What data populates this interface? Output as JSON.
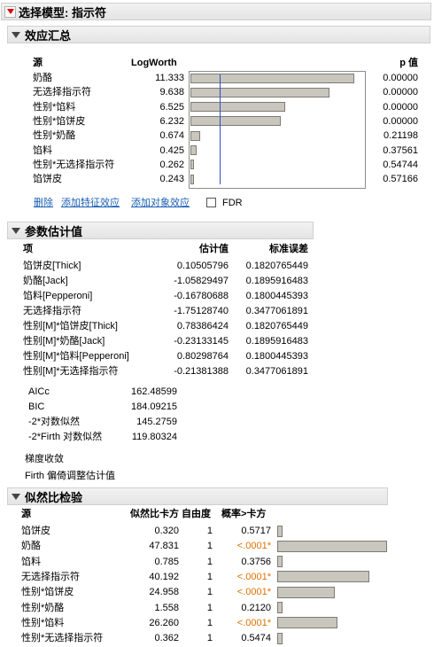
{
  "root_title": "选择模型: 指示符",
  "effect_summary": {
    "title": "效应汇总",
    "columns": {
      "source": "源",
      "logworth": "LogWorth",
      "pvalue": "p 值"
    },
    "rows": [
      {
        "source": "奶酪",
        "logworth": "11.333",
        "lw": 11.333,
        "p": "0.00000"
      },
      {
        "source": "无选择指示符",
        "logworth": "9.638",
        "lw": 9.638,
        "p": "0.00000"
      },
      {
        "source": "性别*馅料",
        "logworth": "6.525",
        "lw": 6.525,
        "p": "0.00000"
      },
      {
        "source": "性别*馅饼皮",
        "logworth": "6.232",
        "lw": 6.232,
        "p": "0.00000"
      },
      {
        "source": "性别*奶酪",
        "logworth": "0.674",
        "lw": 0.674,
        "p": "0.21198"
      },
      {
        "source": "馅料",
        "logworth": "0.425",
        "lw": 0.425,
        "p": "0.37561"
      },
      {
        "source": "性别*无选择指示符",
        "logworth": "0.262",
        "lw": 0.262,
        "p": "0.54744"
      },
      {
        "source": "馅饼皮",
        "logworth": "0.243",
        "lw": 0.243,
        "p": "0.57166"
      }
    ],
    "reference_logworth": 2,
    "max_logworth": 12,
    "actions": {
      "remove": "删除",
      "add_feature": "添加特征效应",
      "add_subject": "添加对象效应",
      "fdr": "FDR"
    }
  },
  "param_estimates": {
    "title": "参数估计值",
    "columns": {
      "term": "项",
      "estimate": "估计值",
      "stderr": "标准误差"
    },
    "rows": [
      {
        "term": "馅饼皮[Thick]",
        "estimate": "0.10505796",
        "stderr": "0.1820765449"
      },
      {
        "term": "奶酪[Jack]",
        "estimate": "-1.05829497",
        "stderr": "0.1895916483"
      },
      {
        "term": "馅料[Pepperoni]",
        "estimate": "-0.16780688",
        "stderr": "0.1800445393"
      },
      {
        "term": "无选择指示符",
        "estimate": "-1.75128740",
        "stderr": "0.3477061891"
      },
      {
        "term": "性别[M]*馅饼皮[Thick]",
        "estimate": "0.78386424",
        "stderr": "0.1820765449"
      },
      {
        "term": "性别[M]*奶酪[Jack]",
        "estimate": "-0.23133145",
        "stderr": "0.1895916483"
      },
      {
        "term": "性别[M]*馅料[Pepperoni]",
        "estimate": "0.80298764",
        "stderr": "0.1800445393"
      },
      {
        "term": "性别[M]*无选择指示符",
        "estimate": "-0.21381388",
        "stderr": "0.3477061891"
      }
    ],
    "fit_stats": [
      {
        "label": "AICc",
        "value": "162.48599"
      },
      {
        "label": "BIC",
        "value": "184.09215"
      },
      {
        "label": "-2*对数似然",
        "value": "145.2759"
      },
      {
        "label": "-2*Firth 对数似然",
        "value": "119.80324"
      }
    ],
    "notes": [
      "梯度收敛",
      "Firth 偏倚调整估计值"
    ]
  },
  "lr_tests": {
    "title": "似然比检验",
    "columns": {
      "source": "源",
      "chisq": "似然比卡方",
      "df": "自由度",
      "prob": "概率>卡方"
    },
    "rows": [
      {
        "source": "馅饼皮",
        "chisq": "0.320",
        "chisq_v": 0.32,
        "df": "1",
        "prob": "0.5717",
        "sig": false
      },
      {
        "source": "奶酪",
        "chisq": "47.831",
        "chisq_v": 47.831,
        "df": "1",
        "prob": "<.0001*",
        "sig": true
      },
      {
        "source": "馅料",
        "chisq": "0.785",
        "chisq_v": 0.785,
        "df": "1",
        "prob": "0.3756",
        "sig": false
      },
      {
        "source": "无选择指示符",
        "chisq": "40.192",
        "chisq_v": 40.192,
        "df": "1",
        "prob": "<.0001*",
        "sig": true
      },
      {
        "source": "性别*馅饼皮",
        "chisq": "24.958",
        "chisq_v": 24.958,
        "df": "1",
        "prob": "<.0001*",
        "sig": true
      },
      {
        "source": "性别*奶酪",
        "chisq": "1.558",
        "chisq_v": 1.558,
        "df": "1",
        "prob": "0.2120",
        "sig": false
      },
      {
        "source": "性别*馅料",
        "chisq": "26.260",
        "chisq_v": 26.26,
        "df": "1",
        "prob": "<.0001*",
        "sig": true
      },
      {
        "source": "性别*无选择指示符",
        "chisq": "0.362",
        "chisq_v": 0.362,
        "df": "1",
        "prob": "0.5474",
        "sig": false
      }
    ]
  }
}
